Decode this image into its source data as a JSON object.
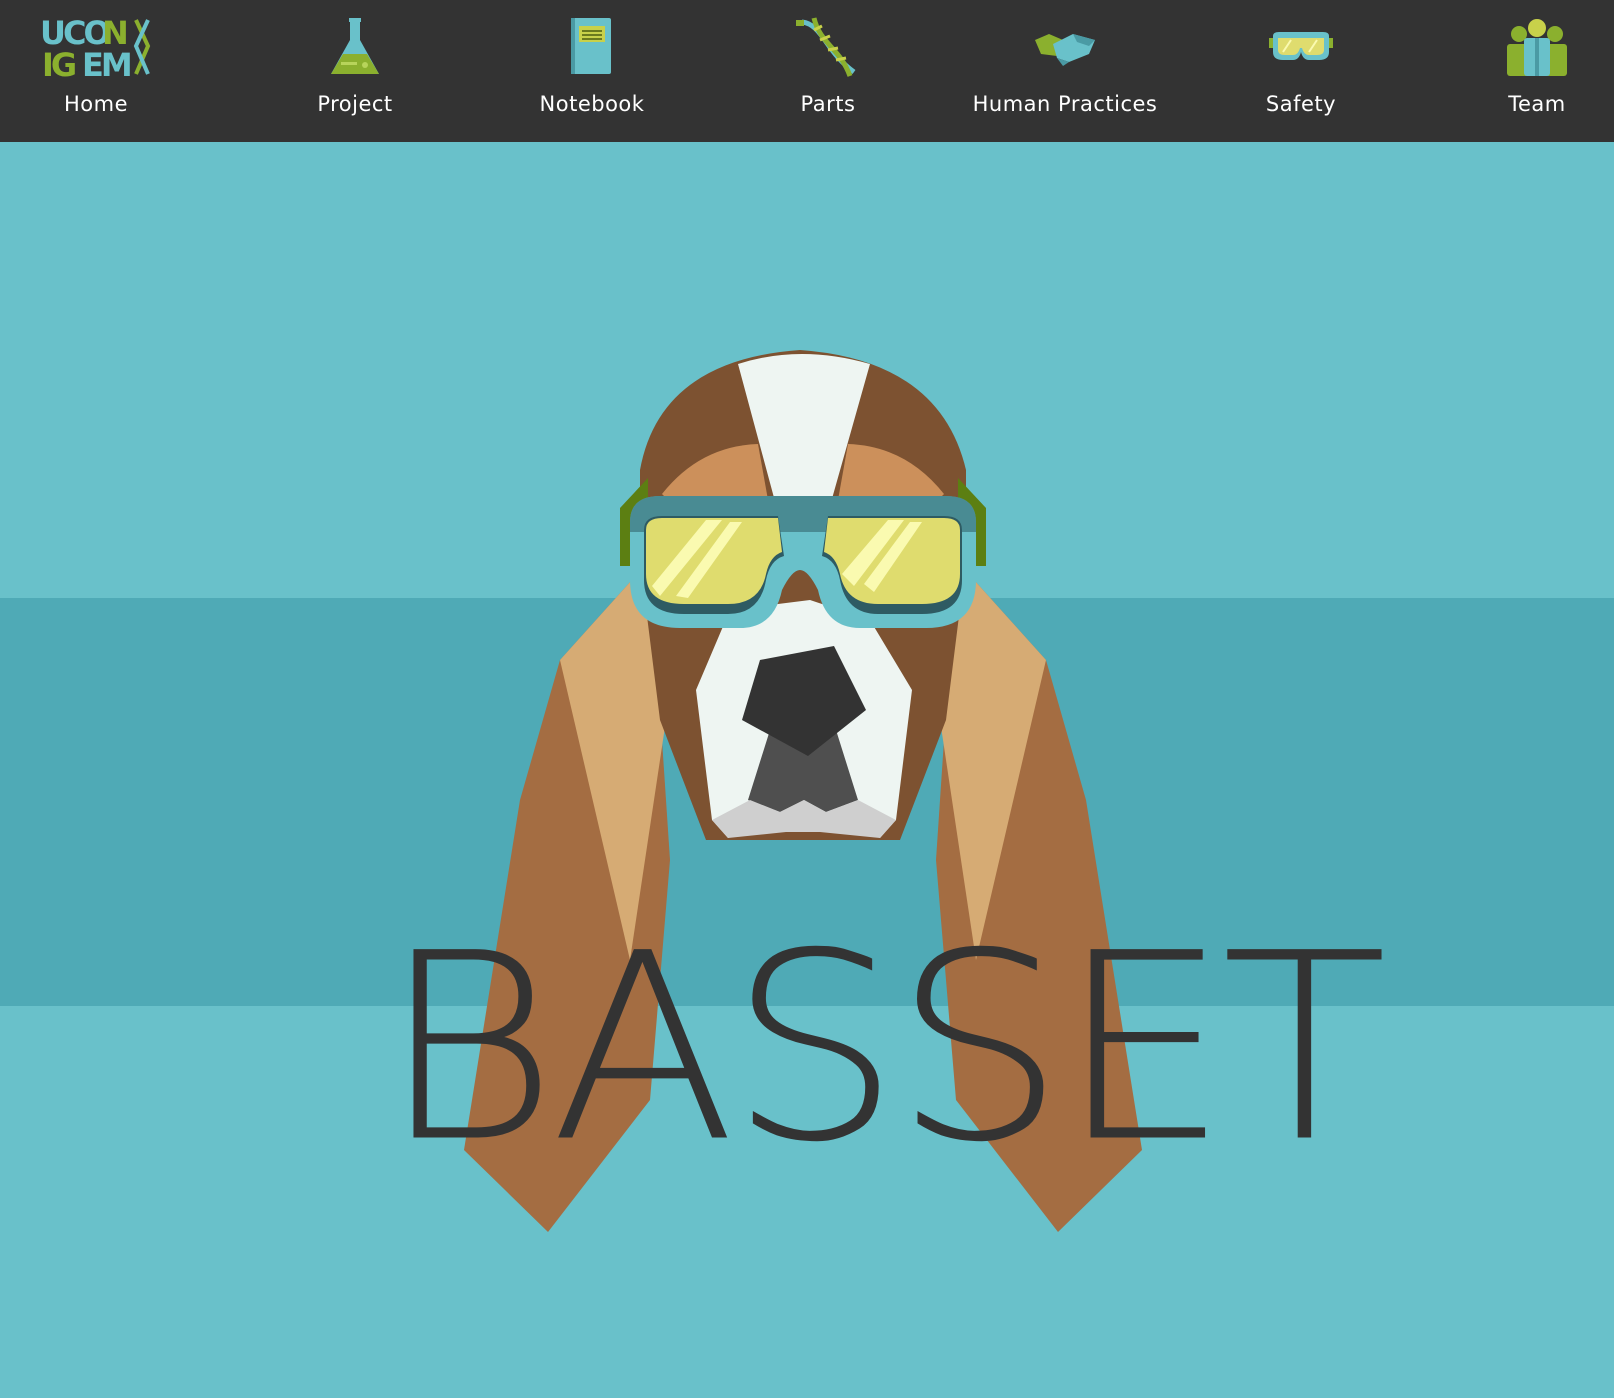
{
  "nav": {
    "items": [
      {
        "label": "Home",
        "icon": "uconn-igem-logo-icon"
      },
      {
        "label": "Project",
        "icon": "flask-icon"
      },
      {
        "label": "Notebook",
        "icon": "notebook-icon"
      },
      {
        "label": "Parts",
        "icon": "dna-icon"
      },
      {
        "label": "Human Practices",
        "icon": "handshake-icon"
      },
      {
        "label": "Safety",
        "icon": "goggles-icon"
      },
      {
        "label": "Team",
        "icon": "team-icon"
      }
    ]
  },
  "hero": {
    "title": "BASSET",
    "mascot": "basset-hound-with-goggles"
  },
  "colors": {
    "nav_bg": "#333333",
    "page_bg": "#69c1ca",
    "band_bg": "#4faab6",
    "accent_green": "#8bb02e",
    "goggle_yellow": "#dfdc6e"
  }
}
